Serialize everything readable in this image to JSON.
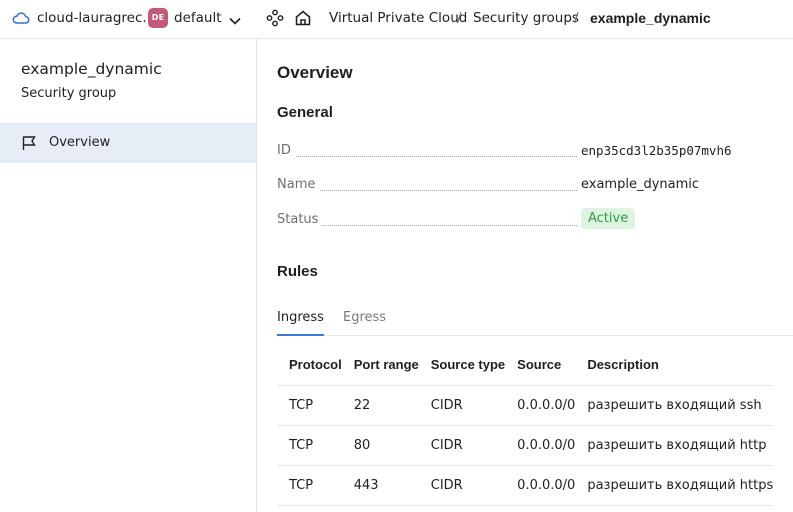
{
  "topbar": {
    "cloud_icon": "cloud-icon",
    "cloud_name": "cloud-lauragrec...",
    "folder_badge": "DE",
    "folder_badge_color": "#c55a78",
    "folder_name": "default",
    "chevron_icon": "chevron-down-icon",
    "services_icon": "services-icon",
    "home_icon": "home-icon",
    "breadcrumbs": [
      {
        "label": "Virtual Private Cloud"
      },
      {
        "label": "Security groups"
      },
      {
        "label": "example_dynamic"
      }
    ],
    "separator": "/"
  },
  "sidebar": {
    "title": "example_dynamic",
    "subtitle": "Security group",
    "items": [
      {
        "label": "Overview",
        "icon": "flag-icon",
        "selected": true
      }
    ]
  },
  "main": {
    "title": "Overview",
    "general": {
      "heading": "General",
      "properties": [
        {
          "key": "ID",
          "value": "enp35cd3l2b35p07mvh6"
        },
        {
          "key": "Name",
          "value": "example_dynamic"
        },
        {
          "key": "Status",
          "value": "Active",
          "status_color": "#2f9e44"
        }
      ]
    },
    "rules": {
      "heading": "Rules",
      "tabs": [
        {
          "label": "Ingress",
          "active": true
        },
        {
          "label": "Egress",
          "active": false
        }
      ],
      "columns": [
        "Protocol",
        "Port range",
        "Source type",
        "Source",
        "Description"
      ],
      "rows": [
        [
          "TCP",
          "22",
          "CIDR",
          "0.0.0.0/0",
          "разрешить входящий ssh"
        ],
        [
          "TCP",
          "80",
          "CIDR",
          "0.0.0.0/0",
          "разрешить входящий http"
        ],
        [
          "TCP",
          "443",
          "CIDR",
          "0.0.0.0/0",
          "разрешить входящий https"
        ]
      ]
    }
  },
  "accent_color": "#3a7bd5"
}
